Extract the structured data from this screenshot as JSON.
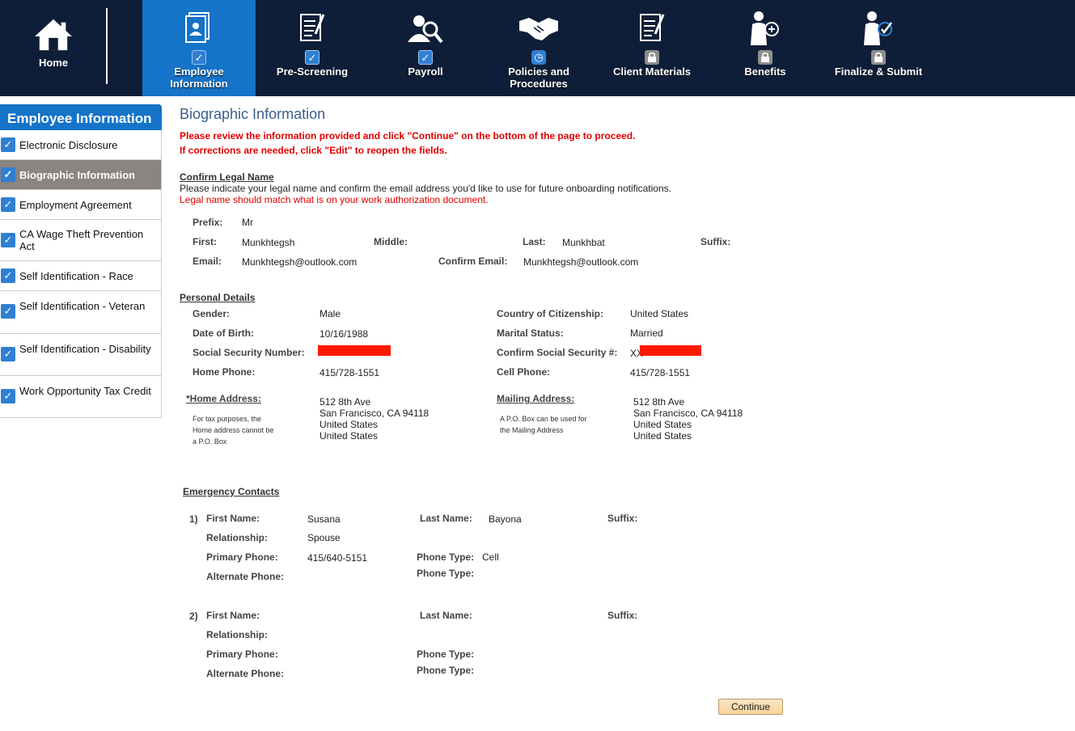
{
  "nav": {
    "home_label": "Home",
    "items": [
      {
        "label_line1": "Employee",
        "label_line2": "Information",
        "status": "check",
        "icon": "id-card-icon"
      },
      {
        "label_line1": "Pre-Screening",
        "label_line2": "",
        "status": "check",
        "icon": "checklist-icon"
      },
      {
        "label_line1": "Payroll",
        "label_line2": "",
        "status": "check",
        "icon": "magnifier-person-icon"
      },
      {
        "label_line1": "Policies and",
        "label_line2": "Procedures",
        "status": "clock",
        "icon": "handshake-icon"
      },
      {
        "label_line1": "Client Materials",
        "label_line2": "",
        "status": "lock",
        "icon": "document-icon"
      },
      {
        "label_line1": "Benefits",
        "label_line2": "",
        "status": "lock",
        "icon": "person-plus-icon"
      },
      {
        "label_line1": "Finalize & Submit",
        "label_line2": "",
        "status": "lock",
        "icon": "person-check-icon"
      }
    ],
    "status_glyphs": {
      "check": "✓",
      "clock": "◷",
      "lock": "🔒"
    }
  },
  "sidebar": {
    "title": "Employee Information",
    "items": [
      {
        "label": "Electronic Disclosure"
      },
      {
        "label": "Biographic Information"
      },
      {
        "label": "Employment Agreement"
      },
      {
        "label": "CA Wage Theft Prevention Act"
      },
      {
        "label": "Self Identification - Race"
      },
      {
        "label": "Self Identification - Veteran"
      },
      {
        "label": "Self Identification - Disability"
      },
      {
        "label": "Work Opportunity Tax Credit"
      }
    ]
  },
  "page": {
    "title": "Biographic Information",
    "warning_1": "Please review the information provided and click \"Continue\" on the bottom of the page to proceed.",
    "warning_2": "If corrections are needed, click \"Edit\" to reopen the fields."
  },
  "legal_name": {
    "heading": "Confirm Legal Name",
    "instructions": "Please indicate your legal name and confirm the email address you'd like to use for future onboarding notifications.",
    "note": "Legal name should match what is on your work authorization document.",
    "prefix_label": "Prefix:",
    "prefix": "Mr",
    "first_label": "First:",
    "first": "Munkhtegsh",
    "middle_label": "Middle:",
    "middle": "",
    "last_label": "Last:",
    "last": "Munkhbat",
    "suffix_label": "Suffix:",
    "suffix": "",
    "email_label": "Email:",
    "email": "Munkhtegsh@outlook.com",
    "confirm_email_label": "Confirm Email:",
    "confirm_email": "Munkhtegsh@outlook.com"
  },
  "personal": {
    "heading": "Personal Details",
    "gender_label": "Gender:",
    "gender": "Male",
    "citizenship_label": "Country of Citizenship:",
    "citizenship": "United States",
    "dob_label": "Date of Birth:",
    "dob": "10/16/1988",
    "marital_label": "Marital Status:",
    "marital": "Married",
    "ssn_label": "Social Security Number:",
    "ssn_prefix": "",
    "confirm_ssn_label": "Confirm Social Security #:",
    "confirm_ssn_prefix": "XX",
    "home_phone_label": "Home Phone:",
    "home_phone": "415/728-1551",
    "cell_phone_label": "Cell Phone:",
    "cell_phone": "415/728-1551",
    "home_address_label": "*Home Address:",
    "home_address_note_1": "For tax purposes, the",
    "home_address_note_2": "Home address cannot be",
    "home_address_note_3": "a P.O. Box",
    "home_address": [
      "512 8th Ave",
      "San Francisco, CA 94118",
      "United States",
      "United States"
    ],
    "mailing_address_label": "Mailing Address:",
    "mailing_address_note_1": "A P.O. Box can be used for",
    "mailing_address_note_2": "the Mailing Address",
    "mailing_address": [
      "512 8th Ave",
      "San Francisco, CA 94118",
      "United States",
      "United States"
    ],
    "redaction_color": "#ff1a00"
  },
  "emergency": {
    "heading": "Emergency Contacts",
    "labels": {
      "first": "First Name:",
      "last": "Last Name:",
      "suffix": "Suffix:",
      "relationship": "Relationship:",
      "primary": "Primary Phone:",
      "alternate": "Alternate Phone:",
      "phone_type": "Phone Type:"
    },
    "contacts": [
      {
        "index": "1)",
        "first": "Susana",
        "last": "Bayona",
        "suffix": "",
        "relationship": "Spouse",
        "primary": "415/640-5151",
        "primary_type": "Cell",
        "alternate": "",
        "alternate_type": ""
      },
      {
        "index": "2)",
        "first": "",
        "last": "",
        "suffix": "",
        "relationship": "",
        "primary": "",
        "primary_type": "",
        "alternate": "",
        "alternate_type": ""
      }
    ]
  },
  "actions": {
    "continue_label": "Continue"
  },
  "colors": {
    "nav_bg": "#0e1e38",
    "accent": "#1573c8",
    "warning": "#e00000",
    "title": "#3a5f8a",
    "active_sidebar": "#8a8482"
  }
}
